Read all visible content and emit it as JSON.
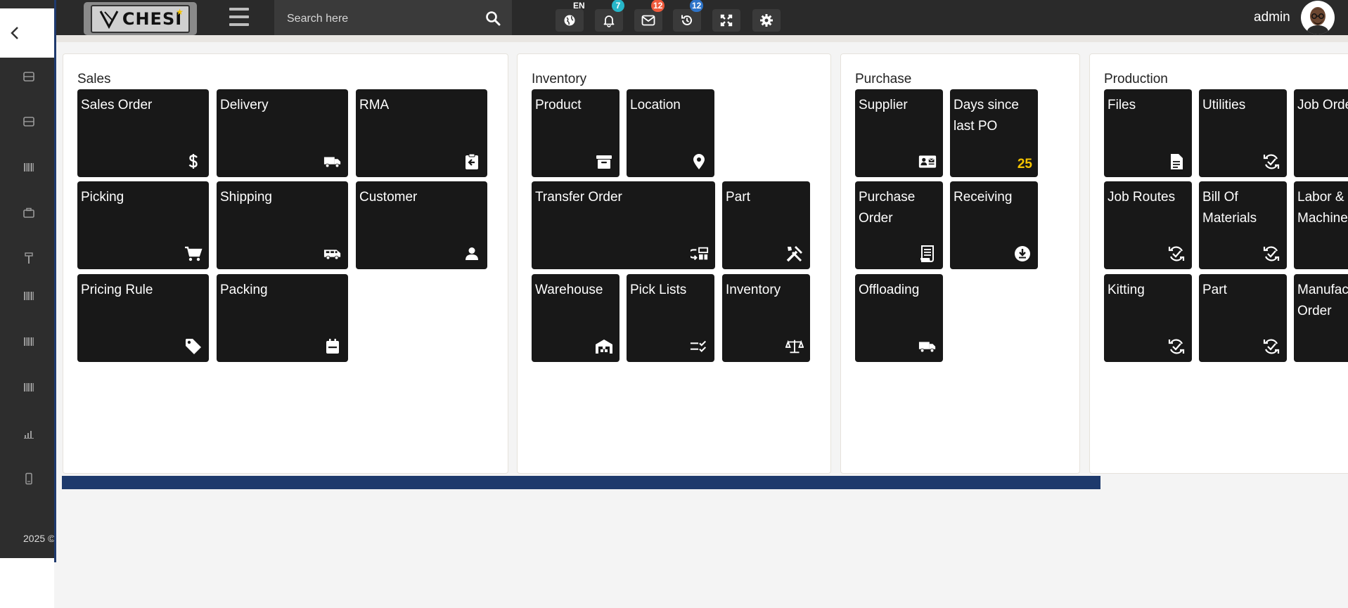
{
  "topbar": {
    "logo_text": "CHESI",
    "search_placeholder": "Search here",
    "language_badge": "EN",
    "notifications_count": "7",
    "messages_count": "12",
    "history_count": "12",
    "user_name": "admin"
  },
  "sidebar": {
    "year": "2025 ©"
  },
  "colors": {
    "topbar_bg": "#2a2a2a",
    "tile_bg": "#181818",
    "accent_navy": "#1e3a6c",
    "badge_teal": "#27b6c9",
    "badge_red": "#ef5a3c",
    "badge_blue": "#2e74c9",
    "highlight_yellow": "#f5c400"
  },
  "panels": {
    "sales": {
      "title": "Sales",
      "tiles": [
        {
          "label": "Sales Order",
          "icon": "dollar-icon"
        },
        {
          "label": "Delivery",
          "icon": "truck-icon"
        },
        {
          "label": "RMA",
          "icon": "clipboard-return-icon"
        },
        {
          "label": "Picking",
          "icon": "cart-icon"
        },
        {
          "label": "Shipping",
          "icon": "van-icon"
        },
        {
          "label": "Customer",
          "icon": "person-icon"
        },
        {
          "label": "Pricing Rule",
          "icon": "tag-icon"
        },
        {
          "label": "Packing",
          "icon": "calendar-box-icon"
        }
      ]
    },
    "inventory": {
      "title": "Inventory",
      "tiles": [
        {
          "label": "Product",
          "icon": "archive-icon"
        },
        {
          "label": "Location",
          "icon": "map-pin-icon"
        },
        {
          "label": "Transfer Order",
          "icon": "transfer-icon"
        },
        {
          "label": "Part",
          "icon": "tools-icon"
        },
        {
          "label": "Warehouse",
          "icon": "warehouse-icon"
        },
        {
          "label": "Pick Lists",
          "icon": "checklist-icon"
        },
        {
          "label": "Inventory",
          "icon": "scale-icon"
        }
      ]
    },
    "purchase": {
      "title": "Purchase",
      "tiles": [
        {
          "label": "Supplier",
          "icon": "contact-card-icon"
        },
        {
          "label": "Days since last PO",
          "value": "25"
        },
        {
          "label": "Purchase Order",
          "icon": "receipt-icon"
        },
        {
          "label": "Receiving",
          "icon": "download-circle-icon"
        },
        {
          "label": "Offloading",
          "icon": "truck-icon"
        }
      ]
    },
    "production": {
      "title": "Production",
      "tiles": [
        {
          "label": "Files",
          "icon": "document-icon"
        },
        {
          "label": "Utilities",
          "icon": "sync-check-icon"
        },
        {
          "label": "Job Order",
          "icon": "sync-check-icon"
        },
        {
          "label": "Job Routes",
          "icon": "sync-check-icon"
        },
        {
          "label": "Bill Of Materials",
          "icon": "sync-check-icon"
        },
        {
          "label": "Labor & Machine",
          "icon": "sync-check-icon"
        },
        {
          "label": "Kitting",
          "icon": "sync-check-icon"
        },
        {
          "label": "Part",
          "icon": "sync-check-icon"
        },
        {
          "label": "Manufacturing Order",
          "icon": "sync-check-icon"
        }
      ]
    }
  }
}
